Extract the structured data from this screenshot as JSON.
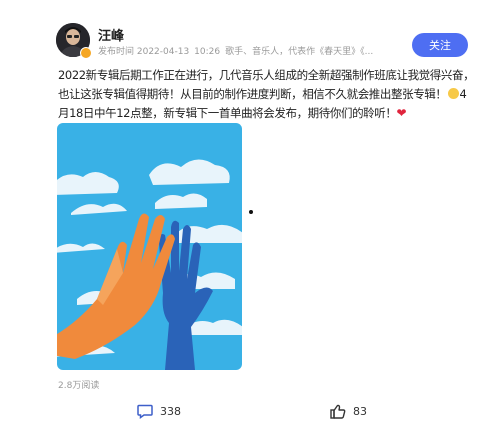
{
  "post": {
    "author": "汪峰",
    "meta_parts": [
      "发布时间 2022-04-13",
      "10:26",
      "歌手、音乐人，代表作《春天里》《..."
    ],
    "follow_label": "关注",
    "text_line1": "2022新专辑后期工作正在进行，几代音乐人组成的全新超强制作班底让我觉得兴奋，",
    "text_line2": "也让这张专辑值得期待！从目前的制作进度判断，相信不久就会推出整张专辑！",
    "text_line3_pre": "4",
    "text_line4": "月18日中午12点整，新专辑下一首单曲将会发布，期待你们的聆听！",
    "heart": "❤",
    "views": "2.8万阅读",
    "comment_count": "338",
    "like_count": "83"
  },
  "colors": {
    "accent": "#4e6ef2",
    "sky": "#39b1e6",
    "orange_hand": "#f08a3c",
    "blue_hand": "#2a63b8",
    "verified_badge": "#f5a623"
  },
  "icons": {
    "avatar": "avatar-photo",
    "verified": "verified-badge-icon",
    "emoji": "smile-emoji-icon",
    "comment": "comment-icon",
    "like": "thumbs-up-icon"
  }
}
